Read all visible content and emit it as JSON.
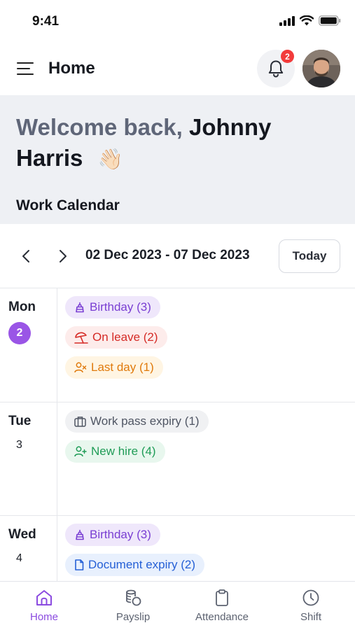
{
  "status_bar": {
    "time": "9:41"
  },
  "header": {
    "title": "Home",
    "notification_count": "2"
  },
  "welcome": {
    "prefix": "Welcome back,",
    "name": "Johnny Harris",
    "emoji": "👋🏻"
  },
  "section_title": "Work Calendar",
  "calendar": {
    "date_range": "02 Dec 2023 - 07 Dec 2023",
    "today_label": "Today",
    "days": [
      {
        "name": "Mon",
        "number": "2",
        "active": true,
        "events": [
          {
            "label": "Birthday (3)",
            "icon": "cake-icon",
            "color": "#7a3fd3"
          },
          {
            "label": "On leave (2)",
            "icon": "beach-umbrella-icon",
            "color": "#d52b26"
          },
          {
            "label": "Last day (1)",
            "icon": "user-remove-icon",
            "color": "#e07a0c"
          }
        ]
      },
      {
        "name": "Tue",
        "number": "3",
        "active": false,
        "events": [
          {
            "label": "Work pass expiry (1)",
            "icon": "briefcase-icon",
            "color": "#4f5563"
          },
          {
            "label": "New hire (4)",
            "icon": "user-add-icon",
            "color": "#1f9c57"
          }
        ]
      },
      {
        "name": "Wed",
        "number": "4",
        "active": false,
        "events": [
          {
            "label": "Birthday (3)",
            "icon": "cake-icon",
            "color": "#7a3fd3"
          },
          {
            "label": "Document expiry (2)",
            "icon": "document-icon",
            "color": "#2560d6"
          }
        ]
      }
    ]
  },
  "bottom_nav": [
    {
      "label": "Home",
      "icon": "home-icon",
      "active": true
    },
    {
      "label": "Payslip",
      "icon": "coins-icon",
      "active": false
    },
    {
      "label": "Attendance",
      "icon": "clipboard-icon",
      "active": false
    },
    {
      "label": "Shift",
      "icon": "clock-icon",
      "active": false
    }
  ],
  "colors": {
    "accent": "#9a55e6",
    "badge": "#f23b3b",
    "welcome_bg": "#eef0f4"
  }
}
